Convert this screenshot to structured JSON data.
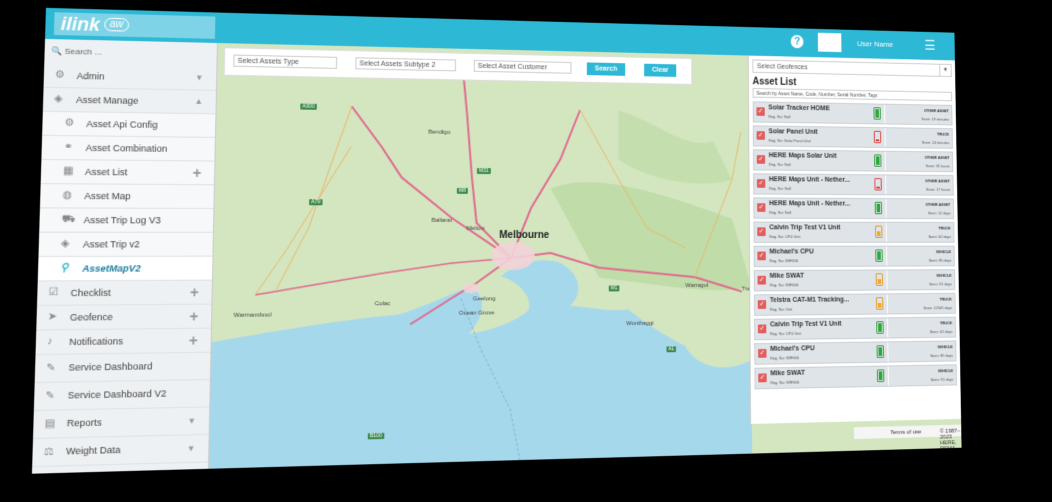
{
  "header": {
    "logo_text": "ilink",
    "logo_sub": "aw",
    "help_label": "?",
    "user_name": "User Name",
    "menu_glyph": "☰"
  },
  "colors": {
    "brand": "#2db8d6",
    "sea": "#a6d8ec",
    "land": "#d4e6c0",
    "road": "#e06a8e",
    "red_check": "#e35d5d",
    "battery_green": "#2ea83d",
    "battery_red": "#d84040",
    "battery_orange": "#f0a92a"
  },
  "sidebar": {
    "search_placeholder": "Search ...",
    "items": [
      {
        "label": "Admin",
        "icon": "gear-icon",
        "suffix": "chevron"
      },
      {
        "label": "Asset Manage",
        "icon": "layers-icon",
        "suffix": "chevron-up"
      },
      {
        "label": "Asset Api Config",
        "icon": "gear-icon",
        "sub": true
      },
      {
        "label": "Asset Combination",
        "icon": "combine-icon",
        "sub": true
      },
      {
        "label": "Asset List",
        "icon": "table-icon",
        "sub": true,
        "suffix": "plus"
      },
      {
        "label": "Asset Map",
        "icon": "globe-icon",
        "sub": true
      },
      {
        "label": "Asset Trip Log V3",
        "icon": "truck-icon",
        "sub": true
      },
      {
        "label": "Asset Trip v2",
        "icon": "layers-icon",
        "sub": true
      },
      {
        "label": "AssetMapV2",
        "icon": "map-pin-icon",
        "sub": true,
        "active": true
      },
      {
        "label": "Checklist",
        "icon": "checklist-icon",
        "suffix": "plus"
      },
      {
        "label": "Geofence",
        "icon": "navigation-icon",
        "suffix": "plus"
      },
      {
        "label": "Notifications",
        "icon": "bell-icon",
        "suffix": "plus"
      },
      {
        "label": "Service Dashboard",
        "icon": "wrench-icon"
      },
      {
        "label": "Service Dashboard V2",
        "icon": "wrench-icon"
      },
      {
        "label": "Reports",
        "icon": "file-icon",
        "suffix": "chevron"
      },
      {
        "label": "Weight Data",
        "icon": "weight-icon",
        "suffix": "chevron"
      }
    ]
  },
  "filters": {
    "asset_type": "Select Assets Type",
    "asset_subtype": "Select Assets Subtype 2",
    "asset_customer": "Select Asset Customer",
    "search_label": "Search",
    "clear_label": "Clear"
  },
  "map": {
    "city": "Melbourne",
    "places": [
      "Bendigo",
      "Ballarat",
      "Melton",
      "Geelong",
      "Warragul",
      "Traralgon",
      "Colac",
      "Ocean Grove",
      "Warrnambool",
      "Wonthaggi"
    ],
    "road_shields": [
      "A300",
      "M8",
      "M31",
      "A79",
      "B100",
      "M1",
      "A1"
    ],
    "terms_label": "Terms of use",
    "copyright": "© 1987–2023 HERE, PSMA"
  },
  "panel": {
    "geofence_placeholder": "Select Geofences",
    "title": "Asset List",
    "search_placeholder": "Search by Asset Name, Code, Number, Serial Number, Tags",
    "assets": [
      {
        "name": "Solar Tracker HOME",
        "reg": "Reg. No: Null",
        "type": "OTHER ASSET",
        "seen": "Seen: 19 minutes",
        "battery": "green"
      },
      {
        "name": "Solar Panel Unit",
        "reg": "Reg. No: Solar Panel Unit",
        "type": "TRUCK",
        "seen": "Seen: 24 minutes",
        "battery": "red"
      },
      {
        "name": "HERE Maps Solar Unit",
        "reg": "Reg. No: Null",
        "type": "OTHER ASSET",
        "seen": "Seen: 81 hours",
        "battery": "green"
      },
      {
        "name": "HERE Maps Unit - Nether...",
        "reg": "Reg. No: Null",
        "type": "OTHER ASSET",
        "seen": "Seen: 17 hours",
        "battery": "red"
      },
      {
        "name": "HERE Maps Unit - Nether...",
        "reg": "Reg. No: Null",
        "type": "OTHER ASSET",
        "seen": "Seen: 12 days",
        "battery": "green"
      },
      {
        "name": "Calvin Trip Test V1 Unit",
        "reg": "Reg. No: CPU Unit",
        "type": "TRUCK",
        "seen": "Seen: 62 days",
        "battery": "orange"
      },
      {
        "name": "Michael's CPU",
        "reg": "Reg. No: WIF666",
        "type": "VEHICLE",
        "seen": "Seen: 85 days",
        "battery": "green"
      },
      {
        "name": "Mike SWAT",
        "reg": "Reg. No: WIF666",
        "type": "VEHICLE",
        "seen": "Seen: 91 days",
        "battery": "orange"
      },
      {
        "name": "Telstra CAT-M1 Tracking...",
        "reg": "Reg. No: Unit",
        "type": "TRUCK",
        "seen": "Seen: 12345 days",
        "battery": "orange"
      },
      {
        "name": "Calvin Trip Test V1 Unit",
        "reg": "Reg. No: CPU Unit",
        "type": "TRUCK",
        "seen": "Seen: 62 days",
        "battery": "green"
      },
      {
        "name": "Michael's CPU",
        "reg": "Reg. No: WIF666",
        "type": "VEHICLE",
        "seen": "Seen: 85 days",
        "battery": "green"
      },
      {
        "name": "Mike SWAT",
        "reg": "Reg. No: WIF666",
        "type": "VEHICLE",
        "seen": "Seen: 91 days",
        "battery": "green"
      }
    ]
  }
}
